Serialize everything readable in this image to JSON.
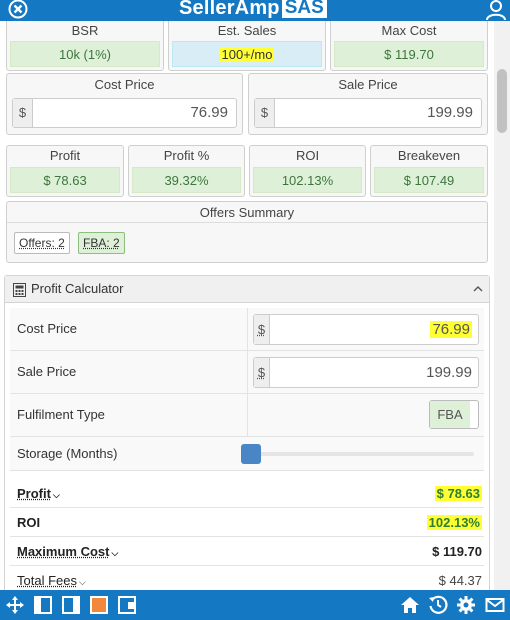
{
  "app": {
    "brand_main": "SellerAmp",
    "brand_box": "SAS"
  },
  "stats": {
    "bsr": {
      "label": "BSR",
      "value": "10k (1%)"
    },
    "est_sales": {
      "label": "Est. Sales",
      "value": "100+/mo"
    },
    "max_cost": {
      "label": "Max Cost",
      "value": "$ 119.70"
    }
  },
  "prices": {
    "cost": {
      "label": "Cost Price",
      "currency": "$",
      "value": "76.99"
    },
    "sale": {
      "label": "Sale Price",
      "currency": "$",
      "value": "199.99"
    }
  },
  "metrics": [
    {
      "label": "Profit",
      "value": "$ 78.63"
    },
    {
      "label": "Profit %",
      "value": "39.32%"
    },
    {
      "label": "ROI",
      "value": "102.13%"
    },
    {
      "label": "Breakeven",
      "value": "$ 107.49"
    }
  ],
  "offers": {
    "title": "Offers Summary",
    "offers_pill": "Offers: 2",
    "fba_pill": "FBA: 2"
  },
  "calculator": {
    "title": "Profit Calculator",
    "cost_label": "Cost Price",
    "cost_currency": "$",
    "cost_value": "76.99",
    "sale_label": "Sale Price",
    "sale_currency": "$",
    "sale_value": "199.99",
    "fulfilment_label": "Fulfilment Type",
    "fulfilment_value": "FBA",
    "storage_label": "Storage (Months)",
    "storage_level": 0,
    "profit_label": "Profit",
    "profit_value": "$ 78.63",
    "roi_label": "ROI",
    "roi_value": "102.13%",
    "max_cost_label": "Maximum Cost",
    "max_cost_value": "$ 119.70",
    "total_fees_label": "Total Fees",
    "total_fees_value": "$ 44.37"
  },
  "colors": {
    "brand": "#1479c2",
    "highlight": "#ffff33",
    "positive": "#2e7d32"
  },
  "icons": {
    "header": [
      "close-icon",
      "user-icon"
    ],
    "footer": [
      "move-icon",
      "panel-left-icon",
      "panel-right-icon",
      "panel-active-icon",
      "panel-mini-icon",
      "home-icon",
      "history-icon",
      "settings-icon",
      "mail-icon"
    ]
  }
}
